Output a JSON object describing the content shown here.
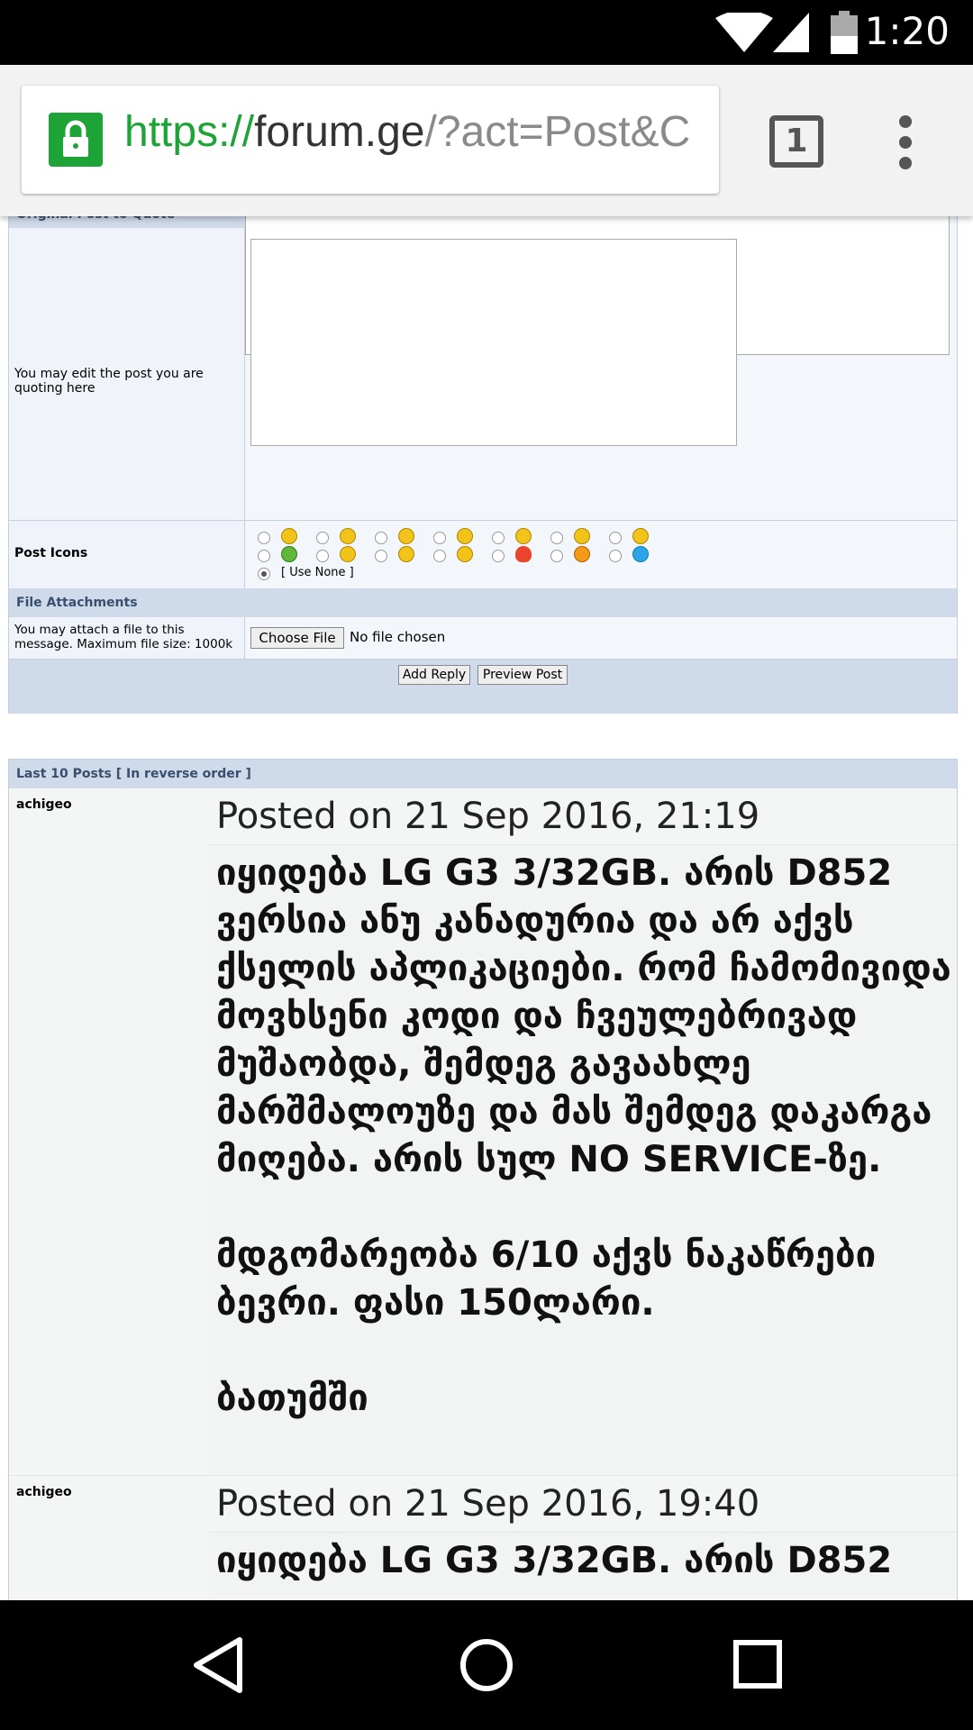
{
  "status_bar": {
    "time": "1:20",
    "icons": [
      "wifi-icon",
      "cell-signal-icon",
      "battery-icon"
    ]
  },
  "browser": {
    "url_scheme": "https://",
    "url_host": "forum.ge",
    "url_path": "/?act=Post&C",
    "tab_count": "1"
  },
  "form": {
    "original_post_header": "Original Post to Quote",
    "edit_quote_label": "You may edit the post you are quoting here",
    "post_icons_label": "Post Icons",
    "use_none_label": "[ Use None ]",
    "file_attachments_header": "File Attachments",
    "attach_label": "You may attach a file to this message. Maximum file size: 1000k",
    "choose_file_label": "Choose File",
    "no_file_label": "No file chosen",
    "add_reply_label": "Add Reply",
    "preview_post_label": "Preview Post"
  },
  "last_posts": {
    "header": "Last 10 Posts [ In reverse order ]",
    "posts": [
      {
        "author": "achigeo",
        "posted": "Posted on 21 Sep 2016, 21:19",
        "body": "იყიდება LG G3 3/32GB. არის D852 ვერსია ანუ კანადურია და არ აქვს ქსელის აპლიკაციები. რომ ჩამომივიდა მოვხსენი კოდი და ჩვეულებრივად მუშაობდა, შემდეგ გავაახლე მარშმალოუზე და მას შემდეგ დაკარგა მიღება. არის სულ NO SERVICE-ზე.\n\nმდგომარეობა 6/10 აქვს ნაკაწრები ბევრი. ფასი 150ლარი.\n\nბათუმში"
      },
      {
        "author": "achigeo",
        "posted": "Posted on 21 Sep 2016, 19:40",
        "body": "იყიდება LG G3 3/32GB. არის D852"
      }
    ]
  },
  "colors": {
    "secure_green": "#1ea337",
    "header_blue": "#cfdaea",
    "label_bg": "#f0f4fa"
  }
}
